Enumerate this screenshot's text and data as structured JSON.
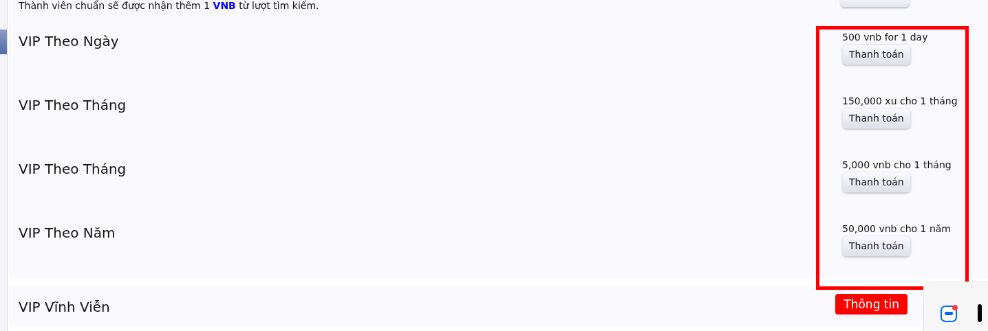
{
  "intro": "Thành viên chuẩn sẽ được nhận thêm 1 **VNB** từ lượt tìm kiếm.",
  "plans": [
    {
      "name": "VIP Theo Ngày",
      "price": "500 vnb for 1 day",
      "button": "Thanh toán"
    },
    {
      "name": "VIP Theo Tháng",
      "price": "150,000 xu cho 1 tháng",
      "button": "Thanh toán"
    },
    {
      "name": "VIP Theo Tháng",
      "price": "5,000 vnb cho 1 tháng",
      "button": "Thanh toán"
    },
    {
      "name": "VIP Theo Năm",
      "price": "50,000 vnb cho 1 năm",
      "button": "Thanh toán"
    }
  ],
  "lifetime": {
    "name": "VIP Vĩnh Viễn",
    "button": "Thông tin"
  }
}
